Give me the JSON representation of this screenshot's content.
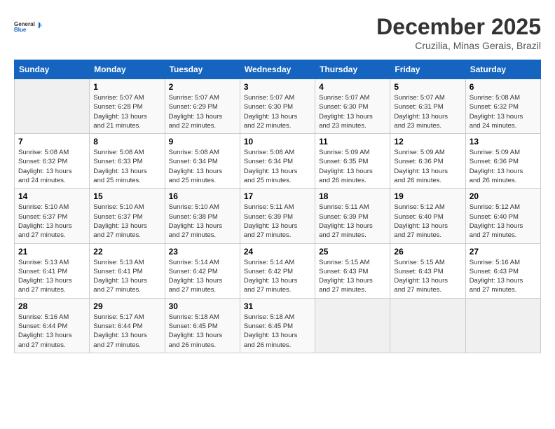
{
  "logo": {
    "line1": "General",
    "line2": "Blue"
  },
  "title": "December 2025",
  "subtitle": "Cruzilia, Minas Gerais, Brazil",
  "weekdays": [
    "Sunday",
    "Monday",
    "Tuesday",
    "Wednesday",
    "Thursday",
    "Friday",
    "Saturday"
  ],
  "weeks": [
    [
      {
        "day": "",
        "info": ""
      },
      {
        "day": "1",
        "info": "Sunrise: 5:07 AM\nSunset: 6:28 PM\nDaylight: 13 hours\nand 21 minutes."
      },
      {
        "day": "2",
        "info": "Sunrise: 5:07 AM\nSunset: 6:29 PM\nDaylight: 13 hours\nand 22 minutes."
      },
      {
        "day": "3",
        "info": "Sunrise: 5:07 AM\nSunset: 6:30 PM\nDaylight: 13 hours\nand 22 minutes."
      },
      {
        "day": "4",
        "info": "Sunrise: 5:07 AM\nSunset: 6:30 PM\nDaylight: 13 hours\nand 23 minutes."
      },
      {
        "day": "5",
        "info": "Sunrise: 5:07 AM\nSunset: 6:31 PM\nDaylight: 13 hours\nand 23 minutes."
      },
      {
        "day": "6",
        "info": "Sunrise: 5:08 AM\nSunset: 6:32 PM\nDaylight: 13 hours\nand 24 minutes."
      }
    ],
    [
      {
        "day": "7",
        "info": "Sunrise: 5:08 AM\nSunset: 6:32 PM\nDaylight: 13 hours\nand 24 minutes."
      },
      {
        "day": "8",
        "info": "Sunrise: 5:08 AM\nSunset: 6:33 PM\nDaylight: 13 hours\nand 25 minutes."
      },
      {
        "day": "9",
        "info": "Sunrise: 5:08 AM\nSunset: 6:34 PM\nDaylight: 13 hours\nand 25 minutes."
      },
      {
        "day": "10",
        "info": "Sunrise: 5:08 AM\nSunset: 6:34 PM\nDaylight: 13 hours\nand 25 minutes."
      },
      {
        "day": "11",
        "info": "Sunrise: 5:09 AM\nSunset: 6:35 PM\nDaylight: 13 hours\nand 26 minutes."
      },
      {
        "day": "12",
        "info": "Sunrise: 5:09 AM\nSunset: 6:36 PM\nDaylight: 13 hours\nand 26 minutes."
      },
      {
        "day": "13",
        "info": "Sunrise: 5:09 AM\nSunset: 6:36 PM\nDaylight: 13 hours\nand 26 minutes."
      }
    ],
    [
      {
        "day": "14",
        "info": "Sunrise: 5:10 AM\nSunset: 6:37 PM\nDaylight: 13 hours\nand 27 minutes."
      },
      {
        "day": "15",
        "info": "Sunrise: 5:10 AM\nSunset: 6:37 PM\nDaylight: 13 hours\nand 27 minutes."
      },
      {
        "day": "16",
        "info": "Sunrise: 5:10 AM\nSunset: 6:38 PM\nDaylight: 13 hours\nand 27 minutes."
      },
      {
        "day": "17",
        "info": "Sunrise: 5:11 AM\nSunset: 6:39 PM\nDaylight: 13 hours\nand 27 minutes."
      },
      {
        "day": "18",
        "info": "Sunrise: 5:11 AM\nSunset: 6:39 PM\nDaylight: 13 hours\nand 27 minutes."
      },
      {
        "day": "19",
        "info": "Sunrise: 5:12 AM\nSunset: 6:40 PM\nDaylight: 13 hours\nand 27 minutes."
      },
      {
        "day": "20",
        "info": "Sunrise: 5:12 AM\nSunset: 6:40 PM\nDaylight: 13 hours\nand 27 minutes."
      }
    ],
    [
      {
        "day": "21",
        "info": "Sunrise: 5:13 AM\nSunset: 6:41 PM\nDaylight: 13 hours\nand 27 minutes."
      },
      {
        "day": "22",
        "info": "Sunrise: 5:13 AM\nSunset: 6:41 PM\nDaylight: 13 hours\nand 27 minutes."
      },
      {
        "day": "23",
        "info": "Sunrise: 5:14 AM\nSunset: 6:42 PM\nDaylight: 13 hours\nand 27 minutes."
      },
      {
        "day": "24",
        "info": "Sunrise: 5:14 AM\nSunset: 6:42 PM\nDaylight: 13 hours\nand 27 minutes."
      },
      {
        "day": "25",
        "info": "Sunrise: 5:15 AM\nSunset: 6:43 PM\nDaylight: 13 hours\nand 27 minutes."
      },
      {
        "day": "26",
        "info": "Sunrise: 5:15 AM\nSunset: 6:43 PM\nDaylight: 13 hours\nand 27 minutes."
      },
      {
        "day": "27",
        "info": "Sunrise: 5:16 AM\nSunset: 6:43 PM\nDaylight: 13 hours\nand 27 minutes."
      }
    ],
    [
      {
        "day": "28",
        "info": "Sunrise: 5:16 AM\nSunset: 6:44 PM\nDaylight: 13 hours\nand 27 minutes."
      },
      {
        "day": "29",
        "info": "Sunrise: 5:17 AM\nSunset: 6:44 PM\nDaylight: 13 hours\nand 27 minutes."
      },
      {
        "day": "30",
        "info": "Sunrise: 5:18 AM\nSunset: 6:45 PM\nDaylight: 13 hours\nand 26 minutes."
      },
      {
        "day": "31",
        "info": "Sunrise: 5:18 AM\nSunset: 6:45 PM\nDaylight: 13 hours\nand 26 minutes."
      },
      {
        "day": "",
        "info": ""
      },
      {
        "day": "",
        "info": ""
      },
      {
        "day": "",
        "info": ""
      }
    ]
  ]
}
